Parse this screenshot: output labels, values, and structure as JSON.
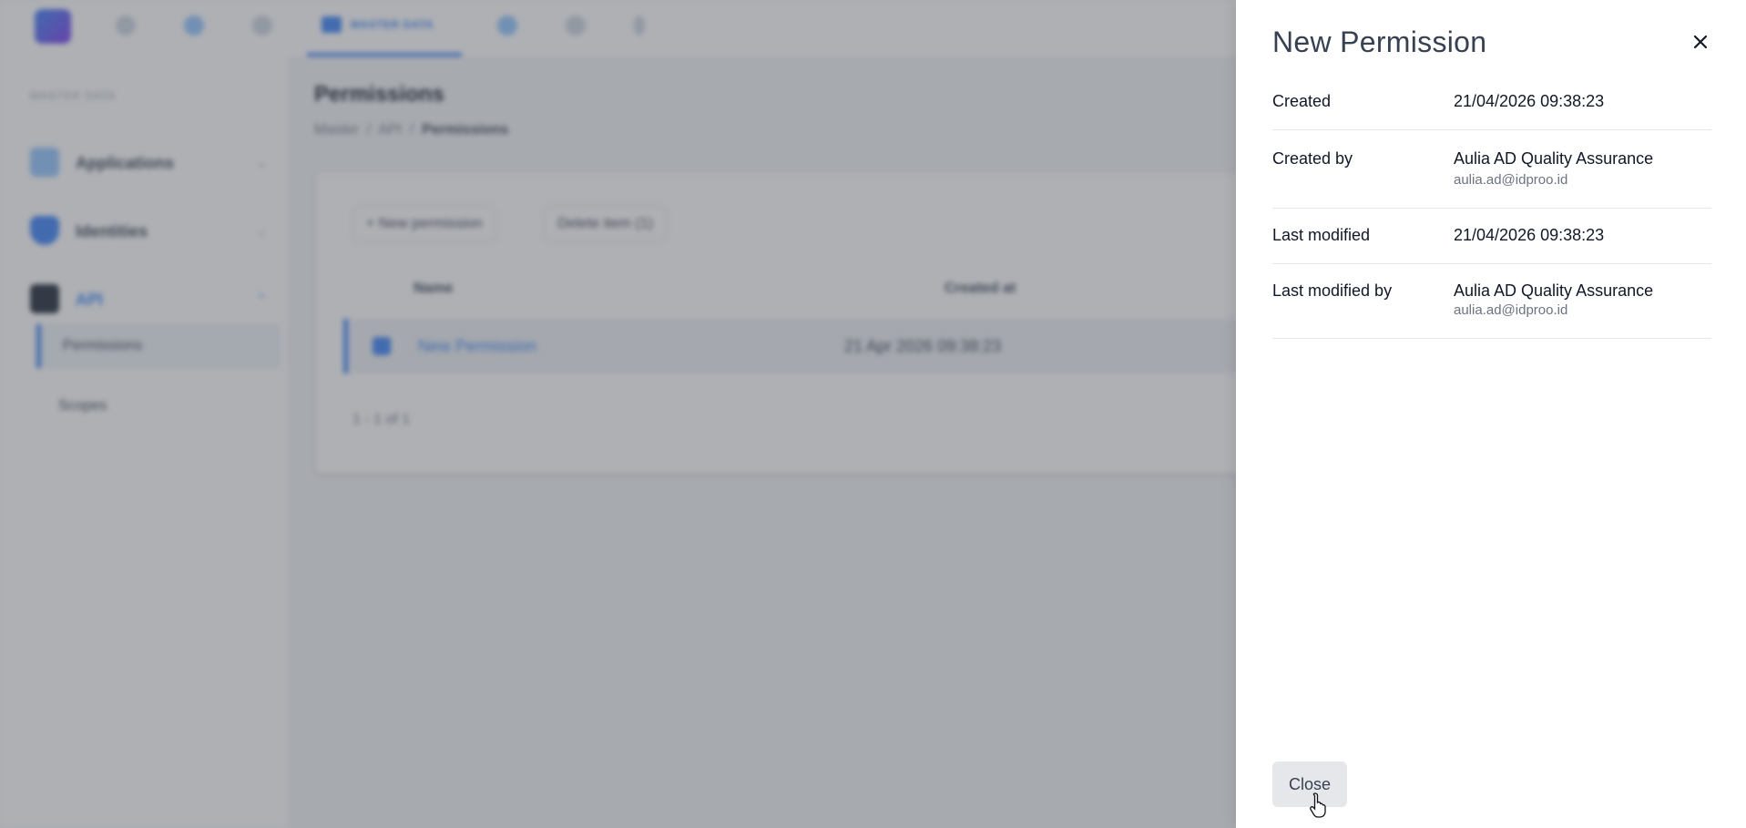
{
  "background": {
    "topnav": {
      "active_label": "MASTER DATA"
    },
    "sidebar": {
      "heading": "MASTER DATA",
      "items": [
        {
          "label": "Applications"
        },
        {
          "label": "Identities"
        },
        {
          "label": "API"
        }
      ],
      "sub_items": [
        {
          "label": "Permissions"
        },
        {
          "label": "Scopes"
        }
      ]
    },
    "page": {
      "title": "Permissions",
      "breadcrumb": [
        "Master",
        "API",
        "Permissions"
      ],
      "buttons": {
        "new": "+ New permission",
        "delete": "Delete item (1)"
      },
      "columns": [
        "Name",
        "Created at"
      ],
      "rows": [
        {
          "name": "New Permission",
          "created_at": "21 Apr 2026 09:38:23"
        }
      ],
      "pager": "1 - 1 of 1"
    }
  },
  "drawer": {
    "title": "New Permission",
    "fields": {
      "created": {
        "label": "Created",
        "value": "21/04/2026 09:38:23"
      },
      "created_by": {
        "label": "Created by",
        "value": "Aulia AD Quality Assurance",
        "email": "aulia.ad@idproo.id"
      },
      "last_modified": {
        "label": "Last modified",
        "value": "21/04/2026 09:38:23"
      },
      "last_modified_by": {
        "label": "Last modified by",
        "value": "Aulia AD Quality Assurance",
        "email": "aulia.ad@idproo.id"
      }
    },
    "close_label": "Close"
  },
  "colors": {
    "accent": "#3b82f6",
    "overlay": "rgba(75,80,88,.45)",
    "button_bg": "#e5e7eb"
  }
}
